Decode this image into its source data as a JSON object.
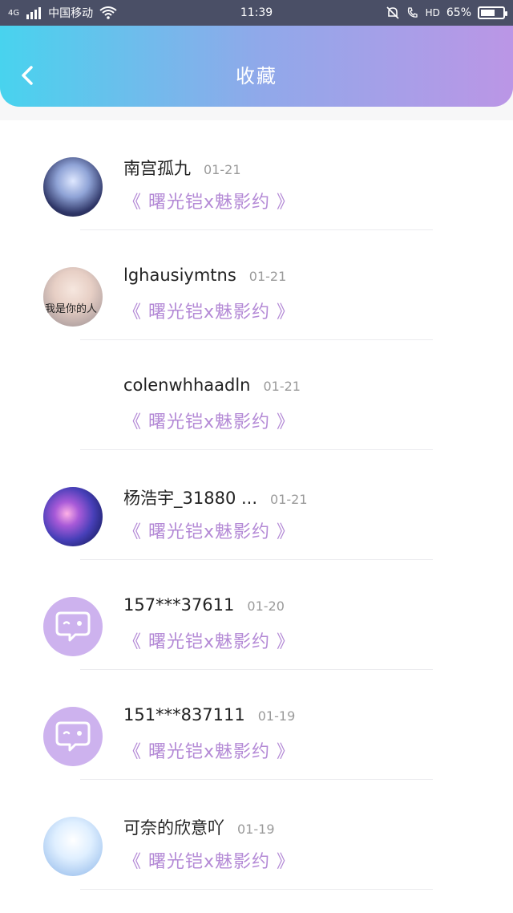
{
  "status_bar": {
    "network": "4G",
    "carrier": "中国移动",
    "time": "11:39",
    "hd": "HD",
    "battery": "65%",
    "battery_level": 0.65
  },
  "header": {
    "title": "收藏"
  },
  "items": [
    {
      "name": "南宫孤九",
      "date": "01-21",
      "book": "《 曙光铠x魅影约 》",
      "avatar": "anime-dark"
    },
    {
      "name": "lghausiymtns",
      "date": "01-21",
      "book": "《 曙光铠x魅影约 》",
      "avatar": "girl",
      "avatar_text": "我是你的人"
    },
    {
      "name": "colenwhhaadln",
      "date": "01-21",
      "book": "《 曙光铠x魅影约 》",
      "avatar": "blank"
    },
    {
      "name": "杨浩宇_31880 ...",
      "date": "01-21",
      "book": "《 曙光铠x魅影约 》",
      "avatar": "galaxy"
    },
    {
      "name": "157***37611",
      "date": "01-20",
      "book": "《 曙光铠x魅影约 》",
      "avatar": "default"
    },
    {
      "name": "151***837111",
      "date": "01-19",
      "book": "《 曙光铠x魅影约 》",
      "avatar": "default"
    },
    {
      "name": "可奈的欣意吖",
      "date": "01-19",
      "book": "《 曙光铠x魅影约 》",
      "avatar": "anime-light"
    }
  ],
  "colors": {
    "header_gradient_start": "#48d3ee",
    "header_gradient_end": "#bb96e6",
    "book_title": "#b48ad6",
    "default_avatar": "#cdb2ee"
  }
}
